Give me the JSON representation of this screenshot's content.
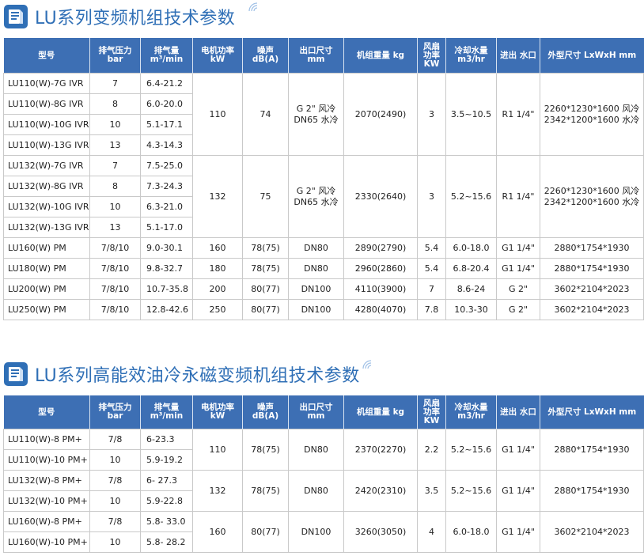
{
  "sections": [
    {
      "title": "LU系列变频机组技术参数"
    },
    {
      "title": "LU系列高能效油冷永磁变频机组技术参数"
    }
  ],
  "headers": [
    "型号",
    "排气压力 bar",
    "排气量 m³/min",
    "电机功率 kW",
    "噪声 dB(A)",
    "出口尺寸 mm",
    "机组重量 kg",
    "风扇 功率 KW",
    "冷却水量 m3/hr",
    "进出 水口",
    "外型尺寸 LxWxH mm"
  ],
  "table1": {
    "g1": {
      "rows": [
        {
          "model": "LU110(W)-7G IVR",
          "bar": "7",
          "flow": "6.4-21.2"
        },
        {
          "model": "LU110(W)-8G IVR",
          "bar": "8",
          "flow": "6.0-20.0"
        },
        {
          "model": "LU110(W)-10G IVR",
          "bar": "10",
          "flow": "5.1-17.1"
        },
        {
          "model": "LU110(W)-13G IVR",
          "bar": "13",
          "flow": "4.3-14.3"
        }
      ],
      "power": "110",
      "noise": "74",
      "outlet_l1": "G 2\"  风冷",
      "outlet_l2": "DN65 水冷",
      "weight": "2070(2490)",
      "fan": "3",
      "water": "3.5~10.5",
      "port": "R1 1/4\"",
      "dim_l1": "2260*1230*1600 风冷",
      "dim_l2": "2342*1200*1600 水冷"
    },
    "g2": {
      "rows": [
        {
          "model": "LU132(W)-7G IVR",
          "bar": "7",
          "flow": "7.5-25.0"
        },
        {
          "model": "LU132(W)-8G IVR",
          "bar": "8",
          "flow": "7.3-24.3"
        },
        {
          "model": "LU132(W)-10G IVR",
          "bar": "10",
          "flow": "6.3-21.0"
        },
        {
          "model": "LU132(W)-13G IVR",
          "bar": "13",
          "flow": "5.1-17.0"
        }
      ],
      "power": "132",
      "noise": "75",
      "outlet_l1": "G 2\"  风冷",
      "outlet_l2": "DN65 水冷",
      "weight": "2330(2640)",
      "fan": "3",
      "water": "5.2~15.6",
      "port": "R1 1/4\"",
      "dim_l1": "2260*1230*1600 风冷",
      "dim_l2": "2342*1200*1600 水冷"
    },
    "single": [
      {
        "model": "LU160(W)  PM",
        "bar": "7/8/10",
        "flow": "9.0-30.1",
        "power": "160",
        "noise": "78(75)",
        "outlet": "DN80",
        "weight": "2890(2790)",
        "fan": "5.4",
        "water": "6.0-18.0",
        "port": "G1 1/4\"",
        "dim": "2880*1754*1930"
      },
      {
        "model": "LU180(W)  PM",
        "bar": "7/8/10",
        "flow": "9.8-32.7",
        "power": "180",
        "noise": "78(75)",
        "outlet": "DN80",
        "weight": "2960(2860)",
        "fan": "5.4",
        "water": "6.8-20.4",
        "port": "G1 1/4\"",
        "dim": "2880*1754*1930"
      },
      {
        "model": "LU200(W)  PM",
        "bar": "7/8/10",
        "flow": "10.7-35.8",
        "power": "200",
        "noise": "80(77)",
        "outlet": "DN100",
        "weight": "4110(3900)",
        "fan": "7",
        "water": "8.6-24",
        "port": "G 2\"",
        "dim": "3602*2104*2023"
      },
      {
        "model": "LU250(W)  PM",
        "bar": "7/8/10",
        "flow": "12.8-42.6",
        "power": "250",
        "noise": "80(77)",
        "outlet": "DN100",
        "weight": "4280(4070)",
        "fan": "7.8",
        "water": "10.3-30",
        "port": "G 2\"",
        "dim": "3602*2104*2023"
      }
    ]
  },
  "table2": [
    {
      "rows": [
        {
          "model": "LU110(W)-8 PM+",
          "bar": "7/8",
          "flow": "6-23.3"
        },
        {
          "model": "LU110(W)-10 PM+",
          "bar": "10",
          "flow": "5.9-19.2"
        }
      ],
      "power": "110",
      "noise": "78(75)",
      "outlet": "DN80",
      "weight": "2370(2270)",
      "fan": "2.2",
      "water": "5.2~15.6",
      "port": "G1 1/4\"",
      "dim": "2880*1754*1930"
    },
    {
      "rows": [
        {
          "model": "LU132(W)-8 PM+",
          "bar": "7/8",
          "flow": "6- 27.3"
        },
        {
          "model": "LU132(W)-10 PM+",
          "bar": "10",
          "flow": "5.9-22.8"
        }
      ],
      "power": "132",
      "noise": "78(75)",
      "outlet": "DN80",
      "weight": "2420(2310)",
      "fan": "3.5",
      "water": "5.2~15.6",
      "port": "G1 1/4\"",
      "dim": "2880*1754*1930"
    },
    {
      "rows": [
        {
          "model": "LU160(W)-8 PM+",
          "bar": "7/8",
          "flow": "5.8- 33.0"
        },
        {
          "model": "LU160(W)-10 PM+",
          "bar": "10",
          "flow": "5.8- 28.2"
        }
      ],
      "power": "160",
      "noise": "80(77)",
      "outlet": "DN100",
      "weight": "3260(3050)",
      "fan": "4",
      "water": "6.0-18.0",
      "port": "G1 1/4\"",
      "dim": "3602*2104*2023"
    }
  ],
  "colors": {
    "header_bg": "#3d6fb4",
    "title": "#2f6fb6",
    "icon": "#2f6fb6"
  }
}
